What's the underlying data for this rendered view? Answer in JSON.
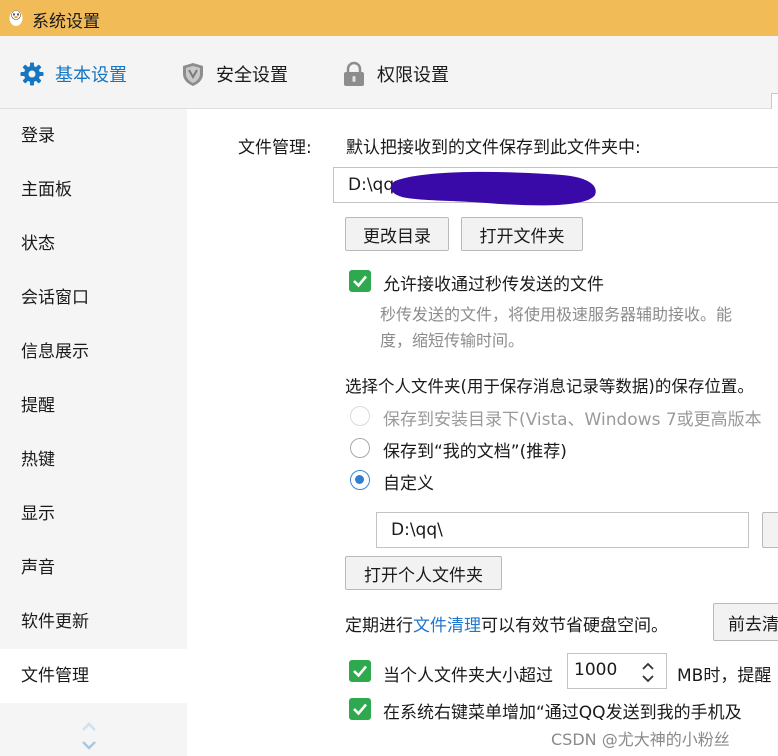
{
  "window": {
    "title": "系统设置"
  },
  "tabs": [
    {
      "label": "基本设置",
      "icon": "gear-icon",
      "active": true
    },
    {
      "label": "安全设置",
      "icon": "shield-icon",
      "active": false
    },
    {
      "label": "权限设置",
      "icon": "lock-icon",
      "active": false
    }
  ],
  "sidebar": {
    "items": [
      {
        "label": "登录"
      },
      {
        "label": "主面板"
      },
      {
        "label": "状态"
      },
      {
        "label": "会话窗口"
      },
      {
        "label": "信息展示"
      },
      {
        "label": "提醒"
      },
      {
        "label": "热键"
      },
      {
        "label": "显示"
      },
      {
        "label": "声音"
      },
      {
        "label": "软件更新"
      },
      {
        "label": "文件管理",
        "active": true
      }
    ]
  },
  "file_management": {
    "section_label": "文件管理:",
    "save_desc": "默认把接收到的文件保存到此文件夹中:",
    "save_path": "D:\\qq",
    "change_dir_button": "更改目录",
    "open_folder_button": "打开文件夹",
    "allow_flash": {
      "label": "允许接收通过秒传发送的文件",
      "checked": true,
      "desc_line1": "秒传发送的文件，将使用极速服务器辅助接收。能",
      "desc_line2": "度，缩短传输时间。"
    },
    "personal_folder_desc": "选择个人文件夹(用于保存消息记录等数据)的保存位置。",
    "radio_options": [
      {
        "label": "保存到安装目录下(Vista、Windows 7或更高版本",
        "state": "disabled"
      },
      {
        "label": "保存到“我的文档”(推荐)",
        "state": "off"
      },
      {
        "label": "自定义",
        "state": "on"
      }
    ],
    "custom_path": "D:\\qq\\",
    "open_personal_folder_button": "打开个人文件夹",
    "cleanup": {
      "text_before": "定期进行",
      "link_text": "文件清理",
      "text_after": "可以有效节省硬盘空间。",
      "button": "前去清"
    },
    "size_warn": {
      "label": "当个人文件夹大小超过",
      "value": "1000",
      "unit_text": "MB时，提醒",
      "checked": true
    },
    "context_menu": {
      "label": "在系统右键菜单增加“通过QQ发送到我的手机及",
      "checked": true
    }
  },
  "watermark": "CSDN @尤大神的小粉丝",
  "colors": {
    "titlebar": "#f1bb58",
    "accent": "#1676c2",
    "checkbox": "#2fa94e",
    "redaction": "#3a0aa8"
  }
}
